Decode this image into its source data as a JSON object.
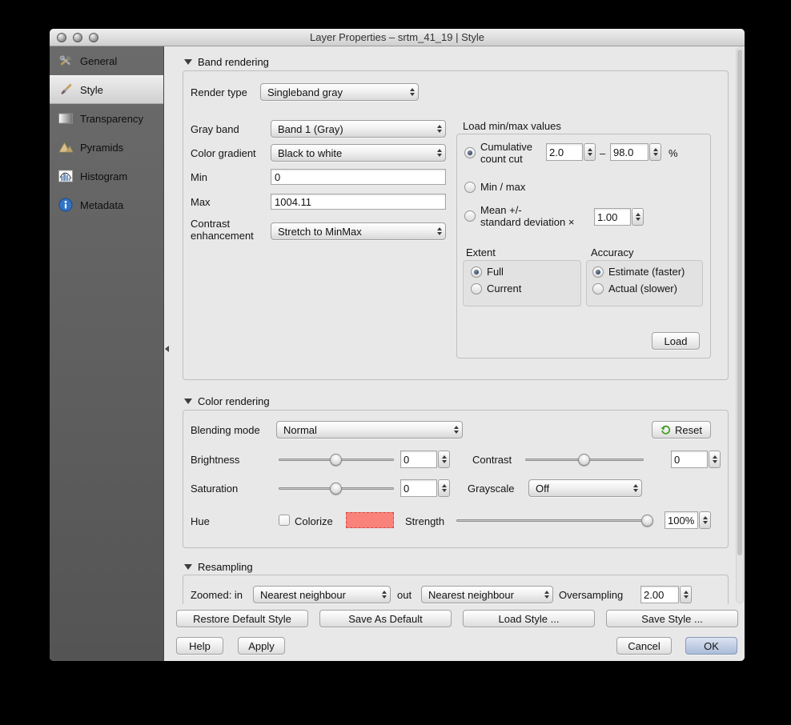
{
  "window": {
    "title": "Layer Properties – srtm_41_19 | Style"
  },
  "sidebar": {
    "items": [
      {
        "label": "General",
        "icon": "tools-icon",
        "selected": false
      },
      {
        "label": "Style",
        "icon": "paintbrush-icon",
        "selected": true
      },
      {
        "label": "Transparency",
        "icon": "transparency-icon",
        "selected": false
      },
      {
        "label": "Pyramids",
        "icon": "pyramids-icon",
        "selected": false
      },
      {
        "label": "Histogram",
        "icon": "histogram-icon",
        "selected": false
      },
      {
        "label": "Metadata",
        "icon": "info-icon",
        "selected": false
      }
    ]
  },
  "band_rendering": {
    "section_title": "Band rendering",
    "render_type": {
      "label": "Render type",
      "value": "Singleband gray"
    },
    "gray_band": {
      "label": "Gray band",
      "value": "Band 1 (Gray)"
    },
    "color_gradient": {
      "label": "Color gradient",
      "value": "Black to white"
    },
    "min": {
      "label": "Min",
      "value": "0"
    },
    "max": {
      "label": "Max",
      "value": "1004.11"
    },
    "contrast_enhancement": {
      "label_line1": "Contrast",
      "label_line2": "enhancement",
      "value": "Stretch to MinMax"
    },
    "load_minmax": {
      "title": "Load min/max values",
      "cumulative": {
        "label_line1": "Cumulative",
        "label_line2": "count cut",
        "selected": true,
        "min": "2.0",
        "separator": "–",
        "max": "98.0",
        "unit": "%"
      },
      "min_max_label": "Min / max",
      "mean": {
        "label_line1": "Mean +/-",
        "label_line2": "standard deviation ×",
        "value": "1.00"
      },
      "extent": {
        "title": "Extent",
        "options": [
          "Full",
          "Current"
        ],
        "selected": "Full"
      },
      "accuracy": {
        "title": "Accuracy",
        "options": [
          "Estimate (faster)",
          "Actual (slower)"
        ],
        "selected": "Estimate (faster)"
      },
      "load_button": "Load"
    }
  },
  "color_rendering": {
    "section_title": "Color rendering",
    "blending_mode": {
      "label": "Blending mode",
      "value": "Normal"
    },
    "reset_button": "Reset",
    "brightness": {
      "label": "Brightness",
      "value": "0"
    },
    "contrast": {
      "label": "Contrast",
      "value": "0"
    },
    "saturation": {
      "label": "Saturation",
      "value": "0"
    },
    "grayscale": {
      "label": "Grayscale",
      "value": "Off"
    },
    "hue": {
      "label": "Hue",
      "colorize_label": "Colorize",
      "colorize_checked": false,
      "strength_label": "Strength",
      "strength_value": "100%"
    }
  },
  "resampling": {
    "section_title": "Resampling",
    "zoomed_in_label": "Zoomed: in",
    "zoomed_in_value": "Nearest neighbour",
    "out_label": "out",
    "zoomed_out_value": "Nearest neighbour",
    "oversampling_label": "Oversampling",
    "oversampling_value": "2.00"
  },
  "footer": {
    "restore_default": "Restore Default Style",
    "save_as_default": "Save As Default",
    "load_style": "Load Style ...",
    "save_style": "Save Style ...",
    "help": "Help",
    "apply": "Apply",
    "cancel": "Cancel",
    "ok": "OK"
  },
  "icons": {
    "reset": "green-undo-arrow",
    "popup_arrows": "up-down-triangles",
    "disclosure": "down-triangle",
    "sidebar_collapse": "left-triangle"
  },
  "colors": {
    "hue_swatch": "#f9827a",
    "ok_button": "#bcc9e0",
    "sidebar_bg": "#5f5f5f",
    "selected_item_bg": "#dcdcdc",
    "reset_icon_green": "#3f9b1e"
  }
}
